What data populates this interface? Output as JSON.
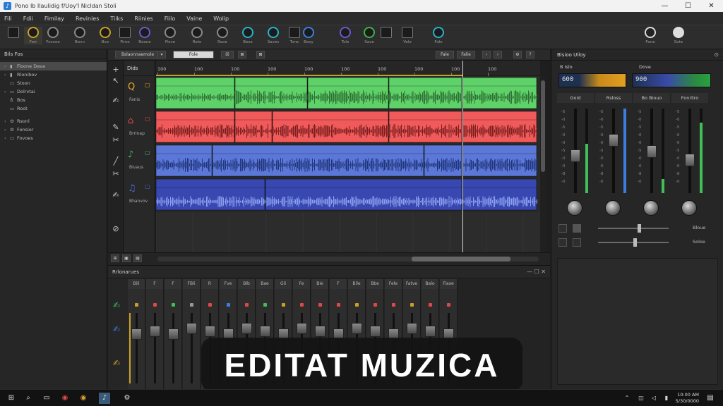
{
  "window": {
    "title": "Pono Ib Ilaulidig f/Uoy'l Nicldan Stoli",
    "controls": [
      "—",
      "☐",
      "✕"
    ]
  },
  "menu": [
    "Fili",
    "Fdii",
    "Fimilay",
    "Revinies",
    "Tiiks",
    "Riinies",
    "Fiilo",
    "Vaine",
    "Wolip"
  ],
  "toolbar": {
    "items": [
      {
        "name": "lines-tool",
        "label": "",
        "style": "sq"
      },
      {
        "name": "pencil-tool",
        "label": "Forr",
        "style": "gold active"
      },
      {
        "name": "curve-tool",
        "label": "Foznoe",
        "style": "plain"
      },
      {
        "name": "knob-a",
        "label": "Bovn",
        "style": "plain"
      },
      {
        "name": "knob-b",
        "label": "Bve",
        "style": "gold"
      },
      {
        "name": "grid-tool",
        "label": "Firne",
        "style": "sq"
      },
      {
        "name": "knob-c",
        "label": "Beone",
        "style": "purple"
      },
      {
        "name": "knob-d",
        "label": "Fiove",
        "style": "plain"
      },
      {
        "name": "knob-e",
        "label": "Rote",
        "style": "plain"
      },
      {
        "name": "knob-f",
        "label": "Raoe",
        "style": "plain"
      },
      {
        "name": "knob-g",
        "label": "Bese",
        "style": "teal"
      },
      {
        "name": "knob-h",
        "label": "Saves",
        "style": "teal"
      },
      {
        "name": "grid-b",
        "label": "Tone",
        "style": "sq"
      },
      {
        "name": "knob-i",
        "label": "Bavy",
        "style": "blue"
      },
      {
        "name": "knob-j",
        "label": "Tole",
        "style": "purple"
      },
      {
        "name": "knob-k",
        "label": "Save",
        "style": "green"
      },
      {
        "name": "record-tool",
        "label": "",
        "style": "sq"
      },
      {
        "name": "knob-l",
        "label": "Vole",
        "style": "sq"
      },
      {
        "name": "knob-m",
        "label": "Fole",
        "style": "teal"
      }
    ],
    "right_items": [
      {
        "name": "headphones",
        "label": "Fone"
      },
      {
        "name": "export",
        "label": "Sote"
      }
    ]
  },
  "browser": {
    "header": "Bils Fos",
    "items": [
      {
        "arrow": "›",
        "glyph": "▮",
        "label": "Fioone Dava",
        "selected": true
      },
      {
        "arrow": "›",
        "glyph": "▮",
        "label": "Rlonibov",
        "selected": false
      },
      {
        "arrow": "",
        "glyph": "▭",
        "label": "Stoon",
        "selected": false
      },
      {
        "arrow": "›",
        "glyph": "▭",
        "label": "Dolrvtai",
        "selected": false
      },
      {
        "arrow": "",
        "glyph": "♁",
        "label": "Bos",
        "selected": false
      },
      {
        "arrow": "",
        "glyph": "▭",
        "label": "Root",
        "selected": false
      },
      {
        "arrow": "›",
        "glyph": "⚙",
        "label": "Rsonl",
        "selected": false
      },
      {
        "arrow": "›",
        "glyph": "⚙",
        "label": "Fonsior",
        "selected": false
      },
      {
        "arrow": "›",
        "glyph": "▭",
        "label": "Fovoes",
        "selected": false
      }
    ]
  },
  "arrange": {
    "strip_buttons": [
      "Bslaonnaemole",
      "▾",
      "Fole",
      "☒",
      "⊠",
      "⊠",
      "Fale",
      "Falie"
    ],
    "header_label": "Dids",
    "ruler_ticks": [
      "100",
      "100",
      "100",
      "100",
      "100",
      "100",
      "100",
      "100",
      "100",
      "100"
    ],
    "tracks": [
      {
        "name": "Fanis",
        "glyph": "Q",
        "color": "#e3a82a",
        "fill": "#5ed168",
        "wave": "#2f6e35"
      },
      {
        "name": "Brrinap",
        "glyph": "⌂",
        "color": "#e04848",
        "fill": "#f05a5a",
        "wave": "#7a1f1f"
      },
      {
        "name": "Bivaus",
        "glyph": "♪",
        "color": "#3fbf5a",
        "fill": "#5b78d8",
        "wave": "#22357a"
      },
      {
        "name": "Bhanvov",
        "glyph": "♫",
        "color": "#4a68d8",
        "fill": "#3848b0",
        "wave": "#8aa0f0"
      }
    ]
  },
  "mixer": {
    "title": "Rrlonarues",
    "channels": [
      "Bili",
      "F",
      "F",
      "FBli",
      "R",
      "Fve",
      "Blb",
      "Bae",
      "Gli",
      "Fe",
      "Bie",
      "F",
      "Bile",
      "Bbe",
      "Fele",
      "Fatve",
      "Balo",
      "Fiaxe"
    ],
    "leds": [
      "#c8a028",
      "#e04848",
      "#3fbf5a",
      "#999",
      "#e04848",
      "#3c7ee0",
      "#e04848",
      "#3fbf5a",
      "#c8a028",
      "#e04848",
      "#e04848",
      "#e04848",
      "#c8a028",
      "#e04848",
      "#e04848",
      "#c8a028",
      "#e04848",
      "#e04848"
    ]
  },
  "inspector": {
    "title": "Blsioo Uiloy",
    "meter_labels": [
      "B Islo",
      "Dove"
    ],
    "meter_values": [
      "600",
      "900"
    ],
    "channels": [
      {
        "name": "Goid"
      },
      {
        "name": "Rsloss"
      },
      {
        "name": "Bo Biouo"
      },
      {
        "name": "Fonrliro"
      }
    ],
    "scale": [
      "-5",
      "-0",
      "-5",
      "-0",
      "-0",
      "-5",
      "-0",
      "-0",
      "-8",
      "-0"
    ],
    "sliders": [
      {
        "label": "Bloue"
      },
      {
        "label": "Soloe"
      }
    ]
  },
  "caption": "EDITAT MUZICA",
  "taskbar": {
    "clock_line1": "10:00 AM",
    "clock_line2": "5/30/0000"
  }
}
